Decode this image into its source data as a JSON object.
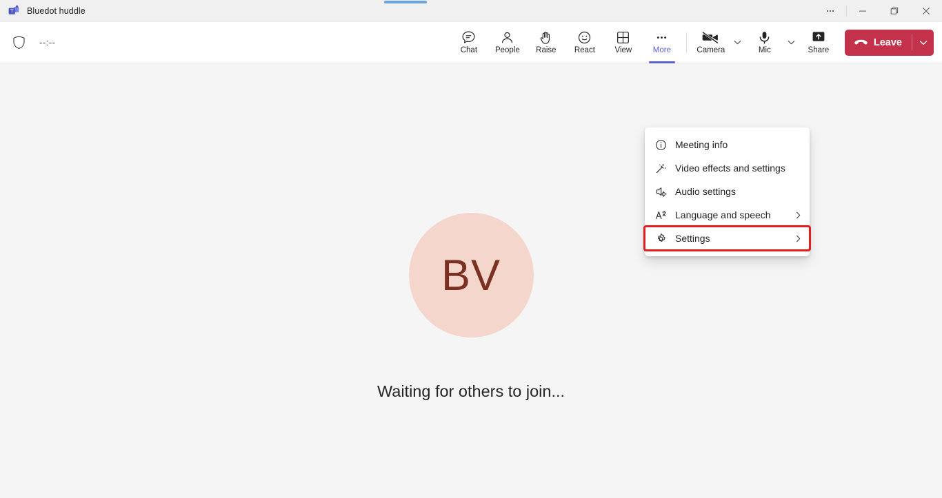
{
  "window": {
    "title": "Bluedot huddle",
    "logo_icon": "teams-logo-icon",
    "controls": [
      {
        "name": "more-window-options",
        "icon": "ellipsis-icon",
        "glyph": "···"
      },
      {
        "name": "minimize",
        "icon": "minimize-icon",
        "glyph": "–"
      },
      {
        "name": "maximize",
        "icon": "maximize-restore-icon",
        "glyph": "❐"
      },
      {
        "name": "close",
        "icon": "close-icon",
        "glyph": "✕"
      }
    ]
  },
  "toolbar": {
    "shield_icon": "shield-icon",
    "timer": "--:--",
    "items": [
      {
        "label": "Chat",
        "icon": "chat-icon"
      },
      {
        "label": "People",
        "icon": "people-icon"
      },
      {
        "label": "Raise",
        "icon": "raise-hand-icon"
      },
      {
        "label": "React",
        "icon": "react-smiley-icon"
      },
      {
        "label": "View",
        "icon": "view-grid-icon"
      },
      {
        "label": "More",
        "icon": "ellipsis-icon",
        "active": true
      }
    ],
    "camera": {
      "label": "Camera",
      "icon": "camera-off-icon",
      "caret_icon": "chevron-down-icon"
    },
    "mic": {
      "label": "Mic",
      "icon": "microphone-icon",
      "caret_icon": "chevron-down-icon"
    },
    "share": {
      "label": "Share",
      "icon": "share-screen-icon"
    },
    "leave": {
      "label": "Leave",
      "icon": "hang-up-icon",
      "caret_icon": "chevron-down-icon"
    }
  },
  "stage": {
    "avatar_initials": "BV",
    "waiting_text": "Waiting for others to join..."
  },
  "more_menu": {
    "items": [
      {
        "label": "Meeting info",
        "icon": "info-circle-icon",
        "has_submenu": false,
        "highlighted": false
      },
      {
        "label": "Video effects and settings",
        "icon": "magic-wand-icon",
        "has_submenu": false,
        "highlighted": false
      },
      {
        "label": "Audio settings",
        "icon": "speaker-gear-icon",
        "has_submenu": false,
        "highlighted": false
      },
      {
        "label": "Language and speech",
        "icon": "translate-icon",
        "has_submenu": true,
        "highlighted": false
      },
      {
        "label": "Settings",
        "icon": "gear-icon",
        "has_submenu": true,
        "highlighted": true
      }
    ],
    "submenu_chevron_icon": "chevron-right-icon"
  },
  "colors": {
    "accent_purple": "#5b5fc7",
    "leave_red": "#c4314b",
    "highlight_red": "#e11d1d",
    "avatar_bg": "#f4d6cd",
    "avatar_fg": "#7a3123",
    "stage_bg": "#f5f5f5"
  }
}
